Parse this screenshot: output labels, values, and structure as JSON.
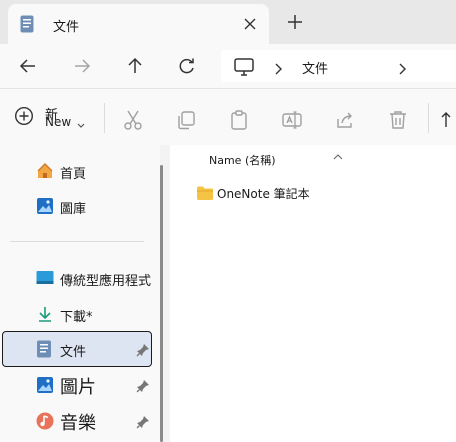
{
  "tab": {
    "title": "文件"
  },
  "address": {
    "crumb": "文件"
  },
  "toolbar": {
    "new_label_zh": "新",
    "new_label_en": "New"
  },
  "sidebar": {
    "items": [
      {
        "label": "首頁"
      },
      {
        "label": "圖庫"
      },
      {
        "label": "傳統型應用程式"
      },
      {
        "label": "下載*"
      },
      {
        "label": "文件"
      },
      {
        "label": "圖片"
      },
      {
        "label": "音樂"
      }
    ]
  },
  "content": {
    "column_header": "Name (名稱)",
    "files": [
      {
        "name": "OneNote 筆記本"
      }
    ]
  },
  "colors": {
    "selected_bg": "#dde5f2",
    "folder": "#f6c445",
    "accent": "#0067c0"
  }
}
